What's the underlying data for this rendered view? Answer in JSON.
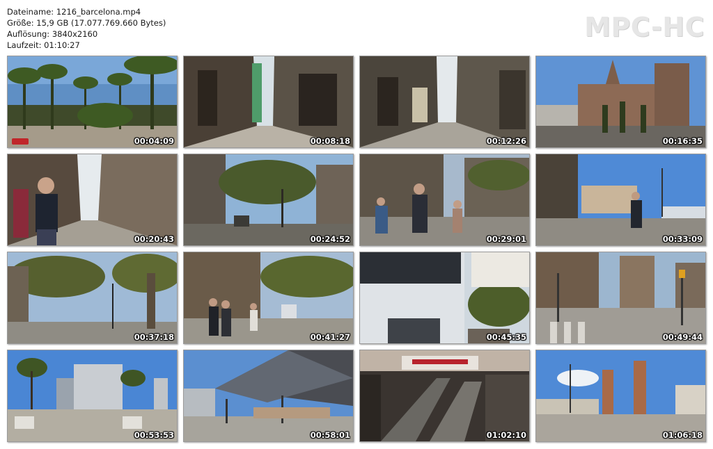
{
  "header": {
    "filename": "Dateiname: 1216_barcelona.mp4",
    "size": "Größe: 15,9 GB (17.077.769.660 Bytes)",
    "resolution": "Auflösung: 3840x2160",
    "duration": "Laufzeit: 01:10:27"
  },
  "logo": "MPC-HC",
  "thumbnails": [
    {
      "time": "00:04:09",
      "scene": "palm-promenade"
    },
    {
      "time": "00:08:18",
      "scene": "narrow-street-scaffold"
    },
    {
      "time": "00:12:26",
      "scene": "narrow-street-shops"
    },
    {
      "time": "00:16:35",
      "scene": "cathedral-facade"
    },
    {
      "time": "00:20:43",
      "scene": "street-pedestrian-mask"
    },
    {
      "time": "00:24:52",
      "scene": "tree-avenue"
    },
    {
      "time": "00:29:01",
      "scene": "street-people-walking"
    },
    {
      "time": "00:33:09",
      "scene": "plaza-bus"
    },
    {
      "time": "00:37:18",
      "scene": "boulevard-trees"
    },
    {
      "time": "00:41:27",
      "scene": "rambla-crowd"
    },
    {
      "time": "00:45:35",
      "scene": "bus-side-closeup"
    },
    {
      "time": "00:49:44",
      "scene": "crosswalk-traffic-lights"
    },
    {
      "time": "00:53:53",
      "scene": "modern-plaza-hotel"
    },
    {
      "time": "00:58:01",
      "scene": "canopy-market"
    },
    {
      "time": "01:02:10",
      "scene": "mall-escalators"
    },
    {
      "time": "01:06:18",
      "scene": "venetian-towers"
    }
  ]
}
